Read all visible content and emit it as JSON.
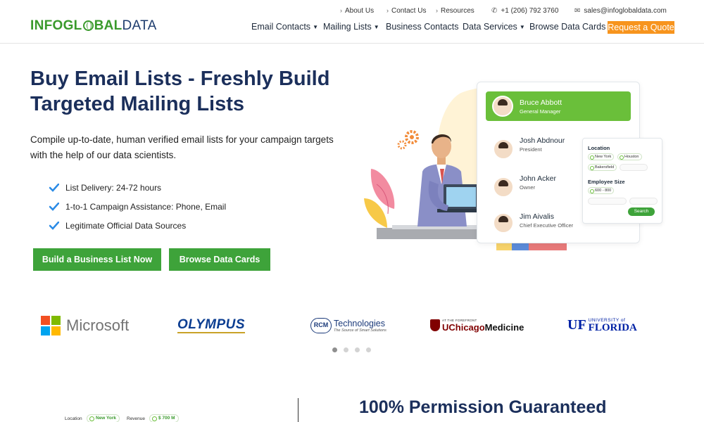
{
  "brand": {
    "logo_part1": "INFOGL",
    "logo_part2": "BAL",
    "logo_part3": "DATA"
  },
  "topbar": {
    "about": "About Us",
    "contact": "Contact Us",
    "resources": "Resources",
    "phone": "+1 (206) 792 3760",
    "email": "sales@infoglobaldata.com"
  },
  "nav": {
    "email_contacts": "Email Contacts",
    "mailing_lists": "Mailing Lists",
    "business_contacts": "Business Contacts",
    "data_services": "Data Services",
    "browse_data_cards": "Browse Data Cards",
    "request_quote": "Request a Quote"
  },
  "hero": {
    "title": "Buy Email Lists - Freshly Build Targeted Mailing Lists",
    "subtitle": "Compile up-to-date, human verified email lists for your campaign targets with the help of our data scientists.",
    "features": [
      "List Delivery: 24-72 hours",
      "1-to-1 Campaign Assistance: Phone, Email",
      "Legitimate Official Data Sources"
    ],
    "btn_build": "Build a Business List Now",
    "btn_browse": "Browse Data Cards"
  },
  "illustration": {
    "contacts": [
      {
        "name": "Bruce Abbott",
        "role": "General Manager"
      },
      {
        "name": "Josh Abdnour",
        "role": "President"
      },
      {
        "name": "John Acker",
        "role": "Owner"
      },
      {
        "name": "Jim Aivalis",
        "role": "Chief Executive Officer"
      }
    ],
    "filter": {
      "location_label": "Location",
      "loc1": "New York",
      "loc2": "Houston",
      "loc3": "Bakersfield",
      "size_label": "Employee Size",
      "size1": "600 - 800",
      "search": "Search"
    }
  },
  "clients": {
    "microsoft": "Microsoft",
    "olympus": "OLYMPUS",
    "rcm_mark": "RCM",
    "rcm_name": "Technologies",
    "rcm_tag": "The Source of Smart Solutions",
    "uc_top": "AT THE FOREFRONT",
    "uc_red": "UChicago",
    "uc_black": "Medicine",
    "uf_mark": "UF",
    "uf_small": "UNIVERSITY of",
    "uf_big": "FLORIDA"
  },
  "bottom": {
    "title": "100% Permission Guaranteed",
    "location_label": "Location",
    "location_value": "New York",
    "revenue_label": "Revenue",
    "revenue_value": "$ 700 M"
  },
  "colors": {
    "brand_green": "#3a9a2c",
    "navy": "#1b2f5b",
    "button_green": "#3ea33a",
    "quote_orange": "#f7941d"
  }
}
